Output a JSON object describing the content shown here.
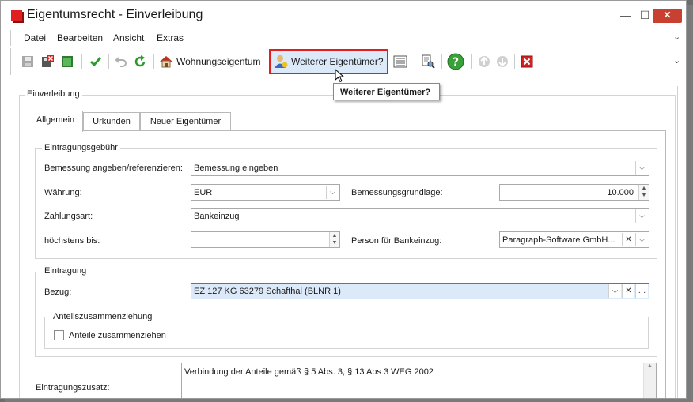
{
  "window": {
    "title": "Eigentumsrecht - Einverleibung"
  },
  "menu": {
    "items": [
      "Datei",
      "Bearbeiten",
      "Ansicht",
      "Extras"
    ]
  },
  "toolbar": {
    "wohnungseigentum_label": "Wohnungseigentum",
    "weiterer_eigentuemer_label": "Weiterer Eigentümer?"
  },
  "tooltip": {
    "text": "Weiterer Eigentümer?"
  },
  "group": {
    "title": "Einverleibung"
  },
  "tabs": [
    "Allgemein",
    "Urkunden",
    "Neuer Eigentümer"
  ],
  "gebuehr": {
    "title": "Eintragungsgebühr",
    "bemessung_label": "Bemessung angeben/referenzieren:",
    "bemessung_value": "Bemessung eingeben",
    "waehrung_label": "Währung:",
    "waehrung_value": "EUR",
    "grundlage_label": "Bemessungsgrundlage:",
    "grundlage_value": "10.000",
    "zahlungsart_label": "Zahlungsart:",
    "zahlungsart_value": "Bankeinzug",
    "hoechstens_label": "höchstens bis:",
    "hoechstens_value": "",
    "person_label": "Person für Bankeinzug:",
    "person_value": "Paragraph-Software GmbH..."
  },
  "eintragung": {
    "title": "Eintragung",
    "bezug_label": "Bezug:",
    "bezug_value": "EZ 127 KG 63279 Schafthal (BLNR 1)",
    "anteil_title": "Anteilszusammenziehung",
    "anteil_checkbox_label": "Anteile zusammenziehen"
  },
  "zusatz": {
    "label": "Eintragungszusatz:",
    "value": "Verbindung der Anteile gemäß § 5 Abs. 3, § 13 Abs  3 WEG 2002"
  },
  "colors": {
    "accent_red": "#e02020",
    "selection": "#dbe9f8",
    "green": "#2e9a2e"
  }
}
